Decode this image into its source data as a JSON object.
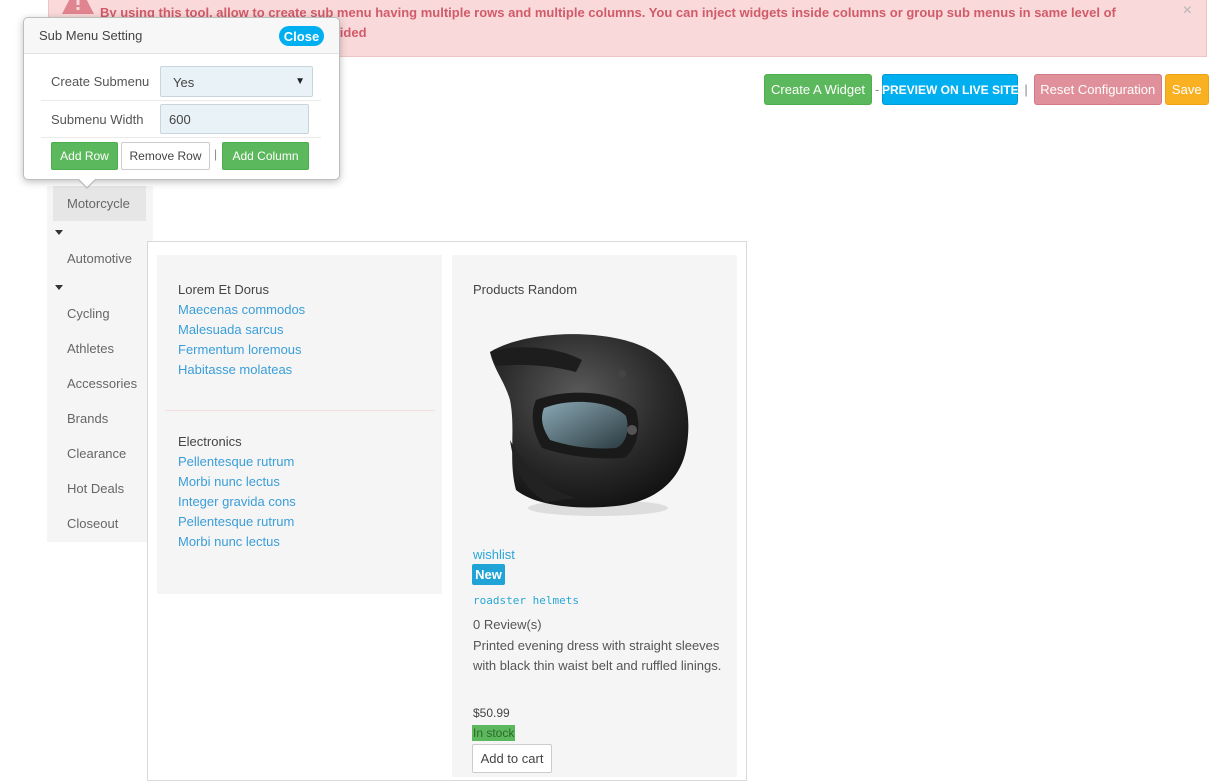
{
  "alert": {
    "text": "By using this tool, allow to create sub menu having multiple rows and multiple columns. You can inject widgets inside columns or group sub menus in same level of parent.Note: width setting will be overrided",
    "close_symbol": "×",
    "icon": "warning-icon"
  },
  "toolbar": {
    "create_widget": "Create A Widget",
    "dash": "-",
    "preview": "PREVIEW ON LIVE SITE",
    "pipe": "|",
    "reset": "Reset Configuration",
    "save": "Save"
  },
  "popover": {
    "title": "Sub Menu Setting",
    "close": "Close",
    "create_submenu_label": "Create Submenu",
    "create_submenu_value": "Yes",
    "submenu_width_label": "Submenu Width",
    "submenu_width_value": "600",
    "add_row": "Add Row",
    "remove_row": "Remove Row",
    "sep": "|",
    "add_column": "Add Column"
  },
  "menu": {
    "items": [
      "Motorcycle",
      "Automotive",
      "Cycling",
      "Athletes",
      "Accessories",
      "Brands",
      "Clearance",
      "Hot Deals",
      "Closeout"
    ]
  },
  "submenu": {
    "col1": {
      "group1_title": "Lorem Et Dorus",
      "group1_links": [
        "Maecenas commodos",
        "Malesuada sarcus",
        "Fermentum loremous",
        "Habitasse molateas"
      ],
      "group2_title": "Electronics",
      "group2_links": [
        "Pellentesque rutrum",
        "Morbi nunc lectus",
        "Integer gravida cons",
        "Pellentesque rutrum",
        "Morbi nunc lectus"
      ]
    },
    "col2": {
      "title": "Products Random",
      "wishlist": "wishlist",
      "badge": "New",
      "product_name": "roadster helmets",
      "reviews": "0 Review(s)",
      "description": "Printed evening dress with straight sleeves with black thin waist belt and ruffled linings.",
      "price": "$50.99",
      "stock": "In stock",
      "add_to_cart": "Add to cart"
    }
  },
  "colors": {
    "alert_bg": "#f9d9d9",
    "alert_text": "#d15b6a",
    "green": "#5cb85c",
    "blue": "#00aff0",
    "red": "#e0909a",
    "yellow": "#f9b122",
    "link": "#3a9ed9"
  }
}
